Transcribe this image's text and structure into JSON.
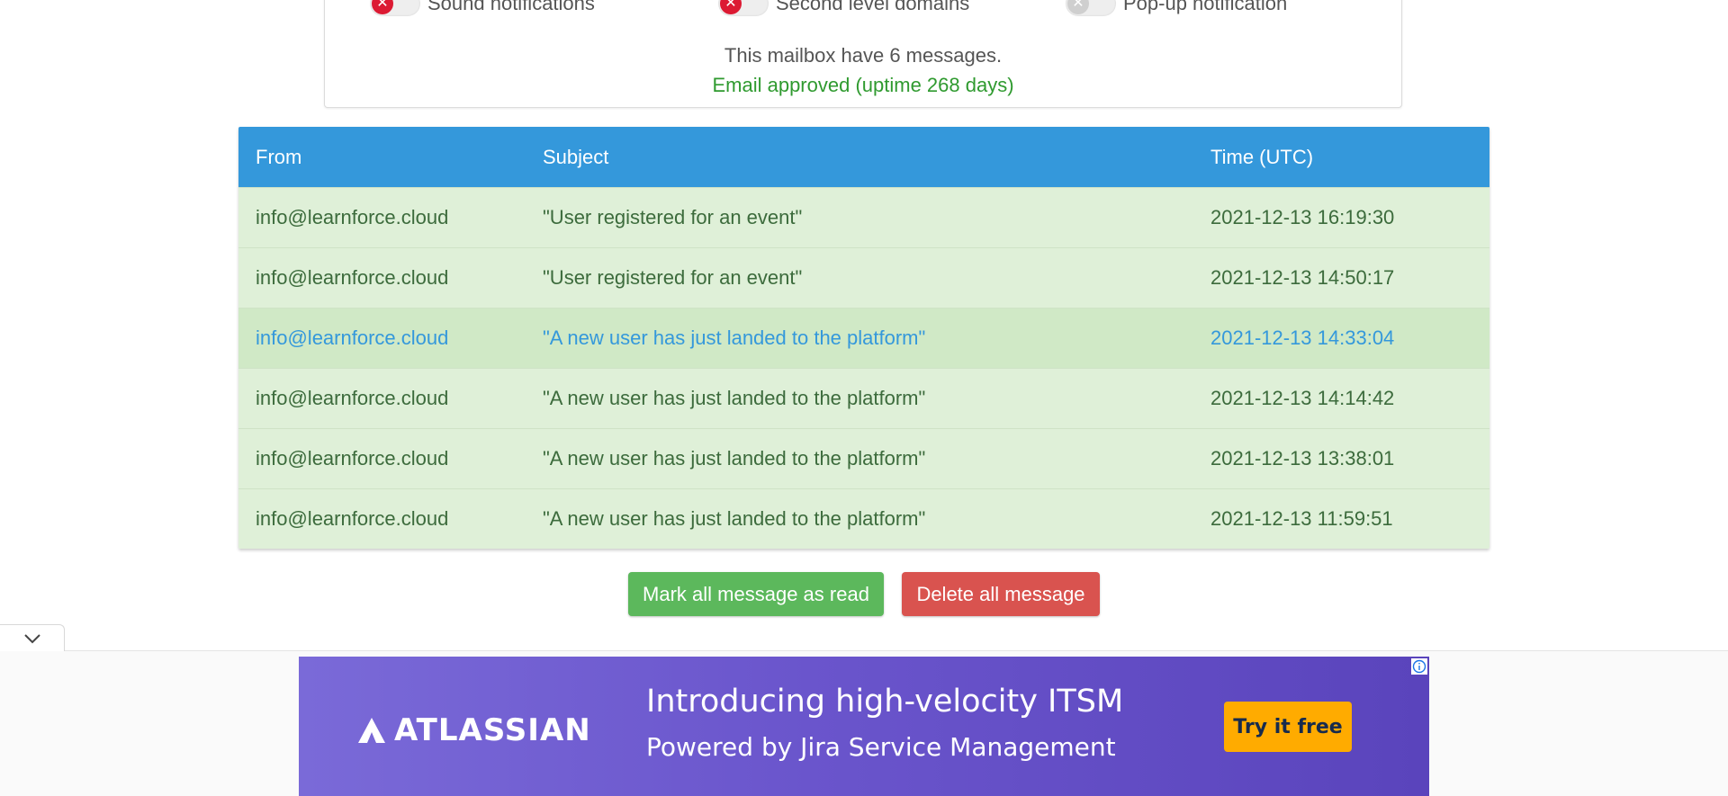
{
  "settings": {
    "toggles": [
      {
        "label": "Sound notifications",
        "state": "on"
      },
      {
        "label": "Second level domains",
        "state": "on"
      },
      {
        "label": "Pop-up notification",
        "state": "off"
      }
    ],
    "mailbox_info": "This mailbox have 6 messages.",
    "status": "Email approved (uptime 268 days)"
  },
  "table": {
    "headers": {
      "from": "From",
      "subject": "Subject",
      "time": "Time (UTC)"
    },
    "rows": [
      {
        "from": "info@learnforce.cloud",
        "subject": "\"User registered for an event\"",
        "time": "2021-12-13 16:19:30"
      },
      {
        "from": "info@learnforce.cloud",
        "subject": "\"User registered for an event\"",
        "time": "2021-12-13 14:50:17"
      },
      {
        "from": "info@learnforce.cloud",
        "subject": "\"A new user has just landed to the platform\"",
        "time": "2021-12-13 14:33:04"
      },
      {
        "from": "info@learnforce.cloud",
        "subject": "\"A new user has just landed to the platform\"",
        "time": "2021-12-13 14:14:42"
      },
      {
        "from": "info@learnforce.cloud",
        "subject": "\"A new user has just landed to the platform\"",
        "time": "2021-12-13 13:38:01"
      },
      {
        "from": "info@learnforce.cloud",
        "subject": "\"A new user has just landed to the platform\"",
        "time": "2021-12-13 11:59:51"
      }
    ]
  },
  "actions": {
    "mark_all_label": "Mark all message as read",
    "delete_all_label": "Delete all message"
  },
  "ad": {
    "brand": "ATLASSIAN",
    "headline": "Introducing high-velocity ITSM",
    "subline": "Powered by Jira Service Management",
    "cta": "Try it free",
    "colors": {
      "cta": "#ffab00",
      "background": "#6a55cc"
    }
  },
  "colors": {
    "table_header": "#3498db",
    "row_background": "#dff0d8",
    "mark_button": "#5cb85c",
    "delete_button": "#d9534f",
    "status_text": "#2f9a2f",
    "toggle_on": "#dc1a33"
  }
}
